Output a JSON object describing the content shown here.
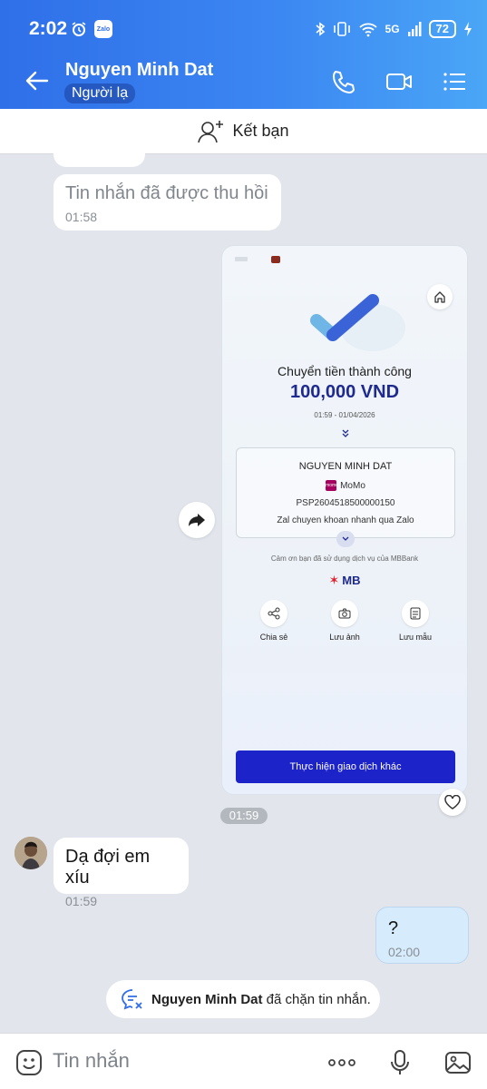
{
  "status_bar": {
    "time": "2:02",
    "app_chip": "Zalo",
    "network": "5G",
    "battery": "72"
  },
  "header": {
    "contact_name": "Nguyen Minh Dat",
    "badge": "Người lạ"
  },
  "add_friend": {
    "label": "Kết bạn"
  },
  "messages": [
    {
      "id": "recalled",
      "text": "Tin nhắn đã được thu hồi",
      "time": "01:58"
    },
    {
      "id": "reply",
      "text": "Dạ đợi em xíu",
      "time": "01:59"
    },
    {
      "id": "mine",
      "text": "?",
      "time": "02:00"
    }
  ],
  "receipt": {
    "title": "Chuyển tiền thành công",
    "amount": "100,000 VND",
    "datetime": "01:59 - 01/04/2026",
    "recipient": "NGUYEN MINH DAT",
    "wallet_logo": "momo",
    "wallet": "MoMo",
    "code": "PSP2604518500000150",
    "message": "Zal chuyen khoan nhanh qua Zalo",
    "thanks": "Cảm ơn bạn đã sử dụng dịch vụ của MBBank",
    "bank_logo": "MB",
    "actions": [
      "Chia sẻ",
      "Lưu ảnh",
      "Lưu mẫu"
    ],
    "cta": "Thực hiện giao dịch khác"
  },
  "image_time": "01:59",
  "system_notice": {
    "name": "Nguyen Minh Dat",
    "text": "đã chặn tin nhắn."
  },
  "composer": {
    "placeholder": "Tin nhắn"
  },
  "colors": {
    "header_start": "#2f6fe8",
    "header_end": "#4aa6f6",
    "cta": "#1c23c9",
    "amount": "#1e2a8f",
    "mine_bubble": "#d6ebfb"
  }
}
